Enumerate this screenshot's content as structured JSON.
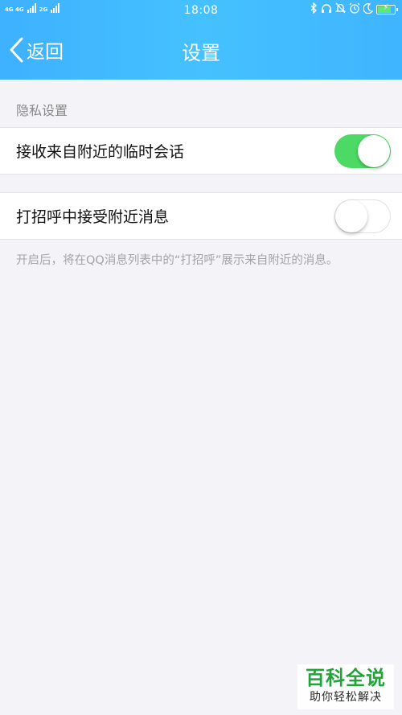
{
  "status_bar": {
    "network_left": "4G 4G",
    "network_right": "2G",
    "time": "18:08",
    "icons": [
      "bluetooth-icon",
      "headset-icon",
      "bell-icon",
      "alarm-icon",
      "moon-icon",
      "battery-icon"
    ]
  },
  "header": {
    "back_label": "返回",
    "title": "设置",
    "background": "#3fb8ff"
  },
  "section": {
    "title": "隐私设置"
  },
  "settings": [
    {
      "label": "接收来自附近的临时会话",
      "enabled": true
    },
    {
      "label": "打招呼中接受附近消息",
      "enabled": false
    }
  ],
  "footnote": "开启后，将在QQ消息列表中的“打招呼”展示来自附近的消息。",
  "watermark": {
    "main": "百科全说",
    "sub": "助你轻松解决"
  },
  "colors": {
    "toggle_on": "#4cd964",
    "page_background": "#f4f4f8",
    "watermark_green": "#1fa537"
  }
}
